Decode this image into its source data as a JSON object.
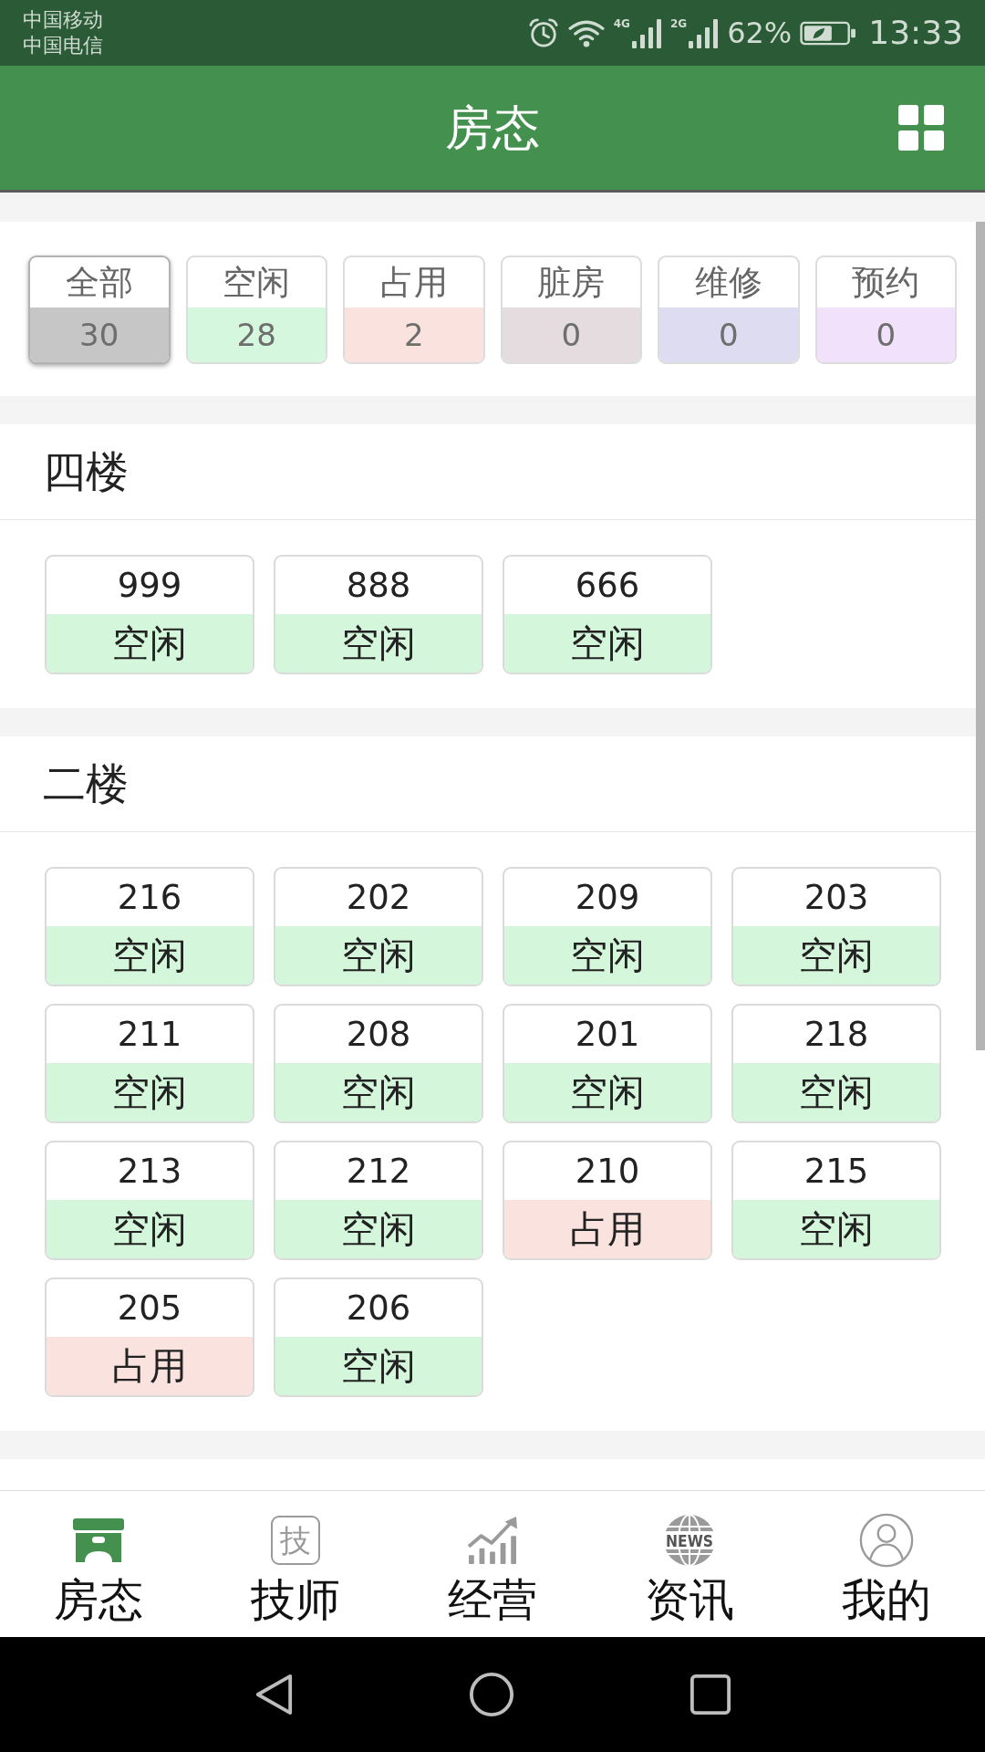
{
  "status_bar": {
    "carriers": [
      "中国移动",
      "中国电信"
    ],
    "networks": [
      {
        "label": "4G"
      },
      {
        "label": "2G"
      }
    ],
    "battery": "62%",
    "time": "13:33"
  },
  "app_bar": {
    "title": "房态"
  },
  "filters": [
    {
      "label": "全部",
      "count": "30",
      "color": "#c6c6c6",
      "selected": true
    },
    {
      "label": "空闲",
      "count": "28",
      "color": "#d5f7dd",
      "selected": false
    },
    {
      "label": "占用",
      "count": "2",
      "color": "#fae3df",
      "selected": false
    },
    {
      "label": "脏房",
      "count": "0",
      "color": "#e5dce0",
      "selected": false
    },
    {
      "label": "维修",
      "count": "0",
      "color": "#dddcf1",
      "selected": false
    },
    {
      "label": "预约",
      "count": "0",
      "color": "#f1e1fa",
      "selected": false
    }
  ],
  "floors": [
    {
      "name": "四楼",
      "rooms": [
        {
          "number": "999",
          "status": "空闲",
          "color": "#d4f7dc"
        },
        {
          "number": "888",
          "status": "空闲",
          "color": "#d4f7dc"
        },
        {
          "number": "666",
          "status": "空闲",
          "color": "#d4f7dc"
        }
      ]
    },
    {
      "name": "二楼",
      "rooms": [
        {
          "number": "216",
          "status": "空闲",
          "color": "#d4f7dc"
        },
        {
          "number": "202",
          "status": "空闲",
          "color": "#d4f7dc"
        },
        {
          "number": "209",
          "status": "空闲",
          "color": "#d4f7dc"
        },
        {
          "number": "203",
          "status": "空闲",
          "color": "#d4f7dc"
        },
        {
          "number": "211",
          "status": "空闲",
          "color": "#d4f7dc"
        },
        {
          "number": "208",
          "status": "空闲",
          "color": "#d4f7dc"
        },
        {
          "number": "201",
          "status": "空闲",
          "color": "#d4f7dc"
        },
        {
          "number": "218",
          "status": "空闲",
          "color": "#d4f7dc"
        },
        {
          "number": "213",
          "status": "空闲",
          "color": "#d4f7dc"
        },
        {
          "number": "212",
          "status": "空闲",
          "color": "#d4f7dc"
        },
        {
          "number": "210",
          "status": "占用",
          "color": "#fae3df"
        },
        {
          "number": "215",
          "status": "空闲",
          "color": "#d4f7dc"
        },
        {
          "number": "205",
          "status": "占用",
          "color": "#fae3df"
        },
        {
          "number": "206",
          "status": "空闲",
          "color": "#d4f7dc"
        }
      ]
    }
  ],
  "bottom_nav": [
    {
      "label": "房态",
      "selected": true
    },
    {
      "label": "技师",
      "icon_text": "技",
      "selected": false
    },
    {
      "label": "经营",
      "selected": false
    },
    {
      "label": "资讯",
      "icon_text": "NEWS",
      "selected": false
    },
    {
      "label": "我的",
      "selected": false
    }
  ]
}
